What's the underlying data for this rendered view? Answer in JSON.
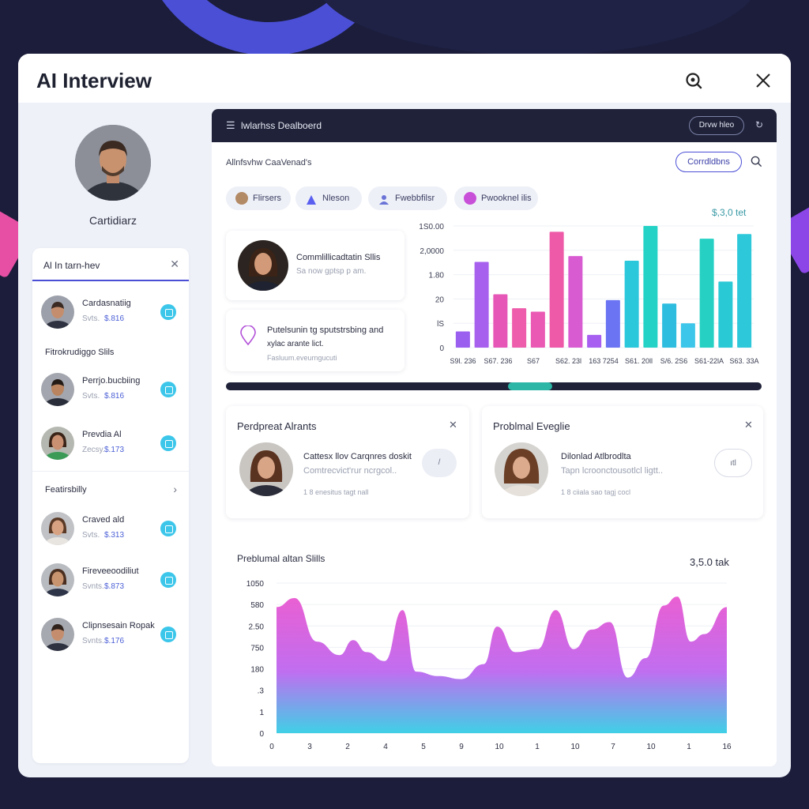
{
  "app": {
    "title": "AI Interview"
  },
  "colors": {
    "accent": "#4b4fd6",
    "teal": "#2bc4d6",
    "pink": "#e35fd0",
    "dark": "#1f2238"
  },
  "candidate": {
    "name": "Cartidiarz"
  },
  "left_panel": {
    "title": "Al In tarn-hev",
    "items_top": [
      {
        "name": "Cardasnatiig",
        "score_label": "Svts.",
        "score": "$.816"
      }
    ],
    "section1": "Fitrokrudiggo Slils",
    "items_mid": [
      {
        "name": "Perrjo.bucbiing",
        "score_label": "Svts.",
        "score": "$.816"
      },
      {
        "name": "Prevdia Al",
        "score_label": "Zecsy.",
        "score": "$.173"
      }
    ],
    "section2": "Featirsbilly",
    "items_bottom": [
      {
        "name": "Craved ald",
        "score_label": "Svts.",
        "score": "$.313"
      },
      {
        "name": "Fireveeoodiliut",
        "score_label": "Svnts.",
        "score": "$.873"
      },
      {
        "name": "Clipnsesain Ropak",
        "score_label": "Svnts.",
        "score": "$.176"
      }
    ]
  },
  "dashboard": {
    "menu_icon": "hamburger-icon",
    "title": "lwlarhss Dealboerd",
    "top_button": "Drvw hleo",
    "subtitle": "Allnfsvhw CaaVenad's",
    "candidates_button": "Corrdldbns",
    "chips": [
      {
        "label": "Flirsers",
        "icon_color": "#b38a66"
      },
      {
        "label": "Nleson",
        "icon_color": "#5a5ff0"
      },
      {
        "label": "Fwebbfilsr",
        "icon_color": "#6b74d6"
      },
      {
        "label": "Pwooknel ilis",
        "icon_color": "#c84fd8"
      }
    ],
    "skill_card": {
      "title": "Commlillicadtatin Sllis",
      "desc": "Sa now gptsp p am."
    },
    "note_card": {
      "line1": "Putelsunin tg sputstrsbing and",
      "line2": "xylac arante lict.",
      "meta": "Fasluum.eveurngucuti"
    }
  },
  "chart_data": [
    {
      "type": "bar",
      "yticks": [
        "1S0.00",
        "2,0000",
        "1.80",
        "20",
        "lS",
        "0"
      ],
      "xticks": [
        "S9l. 236",
        "S67. 236",
        "S67",
        "S62. 23l",
        "163 7254",
        "S61. 20ll",
        "S/6. 2S6",
        "S61-22lA",
        "S63. 33A"
      ],
      "ylim": [
        0,
        100
      ],
      "value_label": "$,3,0 tet",
      "bars": [
        {
          "value": 14,
          "color": "#9b5ff0"
        },
        {
          "value": 74,
          "color": "#a760ee"
        },
        {
          "value": 46,
          "color": "#e556b6"
        },
        {
          "value": 34,
          "color": "#ee5dab"
        },
        {
          "value": 31,
          "color": "#ea5ab4"
        },
        {
          "value": 100,
          "color": "#ee5aa8"
        },
        {
          "value": 79,
          "color": "#d95bd2"
        },
        {
          "value": 11,
          "color": "#a65ff0"
        },
        {
          "value": 41,
          "color": "#6b74f2"
        },
        {
          "value": 75,
          "color": "#2bc8dc"
        },
        {
          "value": 105,
          "color": "#24d3c6"
        },
        {
          "value": 38,
          "color": "#2fbddf"
        },
        {
          "value": 21,
          "color": "#3cc6ea"
        },
        {
          "value": 94,
          "color": "#26d1c4"
        },
        {
          "value": 57,
          "color": "#2ac9d6"
        },
        {
          "value": 98,
          "color": "#2dc8da"
        }
      ]
    },
    {
      "type": "area",
      "title": "Preblumal altan Slills",
      "value_label": "3,5.0 tak",
      "yticks": [
        "1050",
        "580",
        "2.50",
        "750",
        "180",
        ".3",
        "1",
        "0"
      ],
      "xticks": [
        "0",
        "3",
        "2",
        "4",
        "5",
        "9",
        "10",
        "1",
        "10",
        "7",
        "10",
        "1",
        "16"
      ],
      "ylim": [
        0,
        100
      ],
      "x": [
        0,
        4,
        9,
        14,
        17,
        20,
        24,
        28,
        31,
        36,
        41,
        46,
        49,
        53,
        58,
        62,
        66,
        70,
        74,
        78,
        82,
        86,
        89,
        92,
        95,
        100
      ],
      "values": [
        84,
        90,
        61,
        52,
        62,
        54,
        48,
        82,
        41,
        38,
        36,
        46,
        71,
        54,
        56,
        82,
        56,
        69,
        74,
        37,
        50,
        85,
        91,
        61,
        66,
        84
      ]
    }
  ],
  "alerts": [
    {
      "title": "Perdpreat Alrants",
      "name": "Cattesx llov Carqnres doskit",
      "desc": "Comtrecvict'rur ncrgcol..",
      "meta": "1 8 enesitus tagt nall",
      "action": "/"
    },
    {
      "title": "Problmal Eveglie",
      "name": "Dilonlad Atlbrodlta",
      "desc": "Tapn lcroonctousotlcl ligtt..",
      "meta": "1 8 ciiala sao tagj cocl",
      "action": "ıtl"
    }
  ]
}
